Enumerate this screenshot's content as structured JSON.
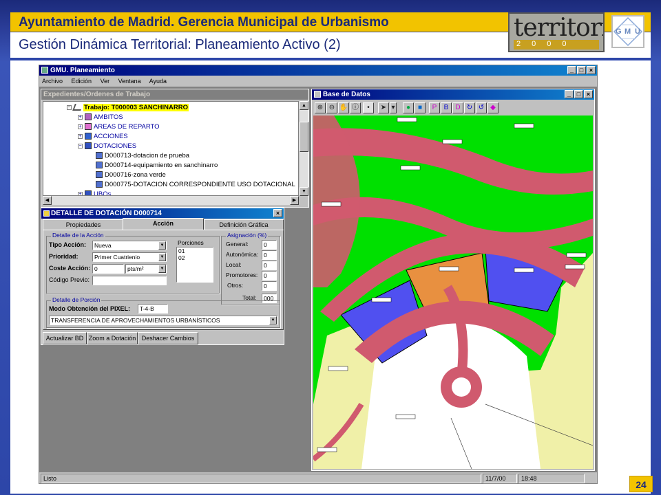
{
  "slide": {
    "title": "Ayuntamiento de Madrid. Gerencia Municipal de Urbanismo",
    "subtitle": "Gestión Dinámica Territorial: Planeamiento Activo (2)",
    "logo_text": "territorial",
    "logo_year": "2000",
    "logo_gmu": [
      "G",
      "M",
      "U"
    ],
    "page_number": "24",
    "colors": {
      "title_bar": "#f2c300",
      "navy": "#1b2a7a",
      "frame_blue": "#2d46a8"
    }
  },
  "app": {
    "window_title": "GMU. Planeamiento",
    "menu": [
      "Archivo",
      "Edición",
      "Ver",
      "Ventana",
      "Ayuda"
    ],
    "status": {
      "text": "Listo",
      "date": "11/7/00",
      "time": "18:48"
    }
  },
  "expedientes": {
    "title": "Expedientes/Ordenes de Trabajo",
    "trabajo": "Trabajo: T000003 SANCHINARRO",
    "items": [
      "AMBITOS",
      "AREAS DE REPARTO",
      "ACCIONES",
      "DOTACIONES"
    ],
    "dotaciones": [
      "D000713-dotacion de prueba",
      "D000714-equipamiento en sanchinarro",
      "D000716-zona verde",
      "D000775-DOTACION CORRESPONDIENTE USO DOTACIONAL"
    ],
    "last_item": "UBOs"
  },
  "detalle": {
    "title": "DETALLE DE DOTACIÓN D000714",
    "tabs": [
      "Propiedades",
      "Acción",
      "Definición Gráfica"
    ],
    "active_tab": "Acción",
    "accion_group": "Detalle de la Acción",
    "tipo_accion_label": "Tipo Acción:",
    "tipo_accion_value": "Nueva",
    "prioridad_label": "Prioridad:",
    "prioridad_value": "Primer Cuatrienio",
    "coste_label": "Coste Acción:",
    "coste_value": "0",
    "coste_unit": "pts/m²",
    "codigo_label": "Código Previo:",
    "porciones_label": "Porciones",
    "porciones": [
      "01",
      "02"
    ],
    "asignacion_group": "Asignación (%)",
    "asignacion": [
      {
        "label": "General:",
        "value": "0"
      },
      {
        "label": "Autonómica:",
        "value": "0"
      },
      {
        "label": "Local:",
        "value": "0"
      },
      {
        "label": "Promotores:",
        "value": "0"
      },
      {
        "label": "Otros:",
        "value": "0"
      }
    ],
    "total_label": "Total:",
    "total_value": "000",
    "porcion_group": "Detalle de Porción",
    "modo_label": "Modo Obtención del PIXEL:",
    "modo_value": "T-4-B",
    "transferencia": "TRANSFERENCIA DE APROVECHAMIENTOS URBANÍSTICOS",
    "buttons": [
      "Actualizar BD",
      "Zoom a Dotación",
      "Deshacer Cambios"
    ]
  },
  "base_datos": {
    "title": "Base de Datos",
    "toolbar_icons": [
      "zoom-in-icon",
      "zoom-out-icon",
      "pan-hand-icon",
      "info-icon",
      "point-icon",
      "select-arrow-icon",
      "globe-icon",
      "layer-icon",
      "p-layer-icon",
      "bd-layer-icon",
      "d-layer-icon",
      "refresh-icon",
      "refresh-alt-icon",
      "pink-layer-icon"
    ],
    "map_colors": {
      "green": "#00e000",
      "road": "#d05a6e",
      "cream": "#f0f0a8",
      "orange": "#e89040",
      "blue": "#5050f0",
      "white": "#ffffff"
    }
  }
}
